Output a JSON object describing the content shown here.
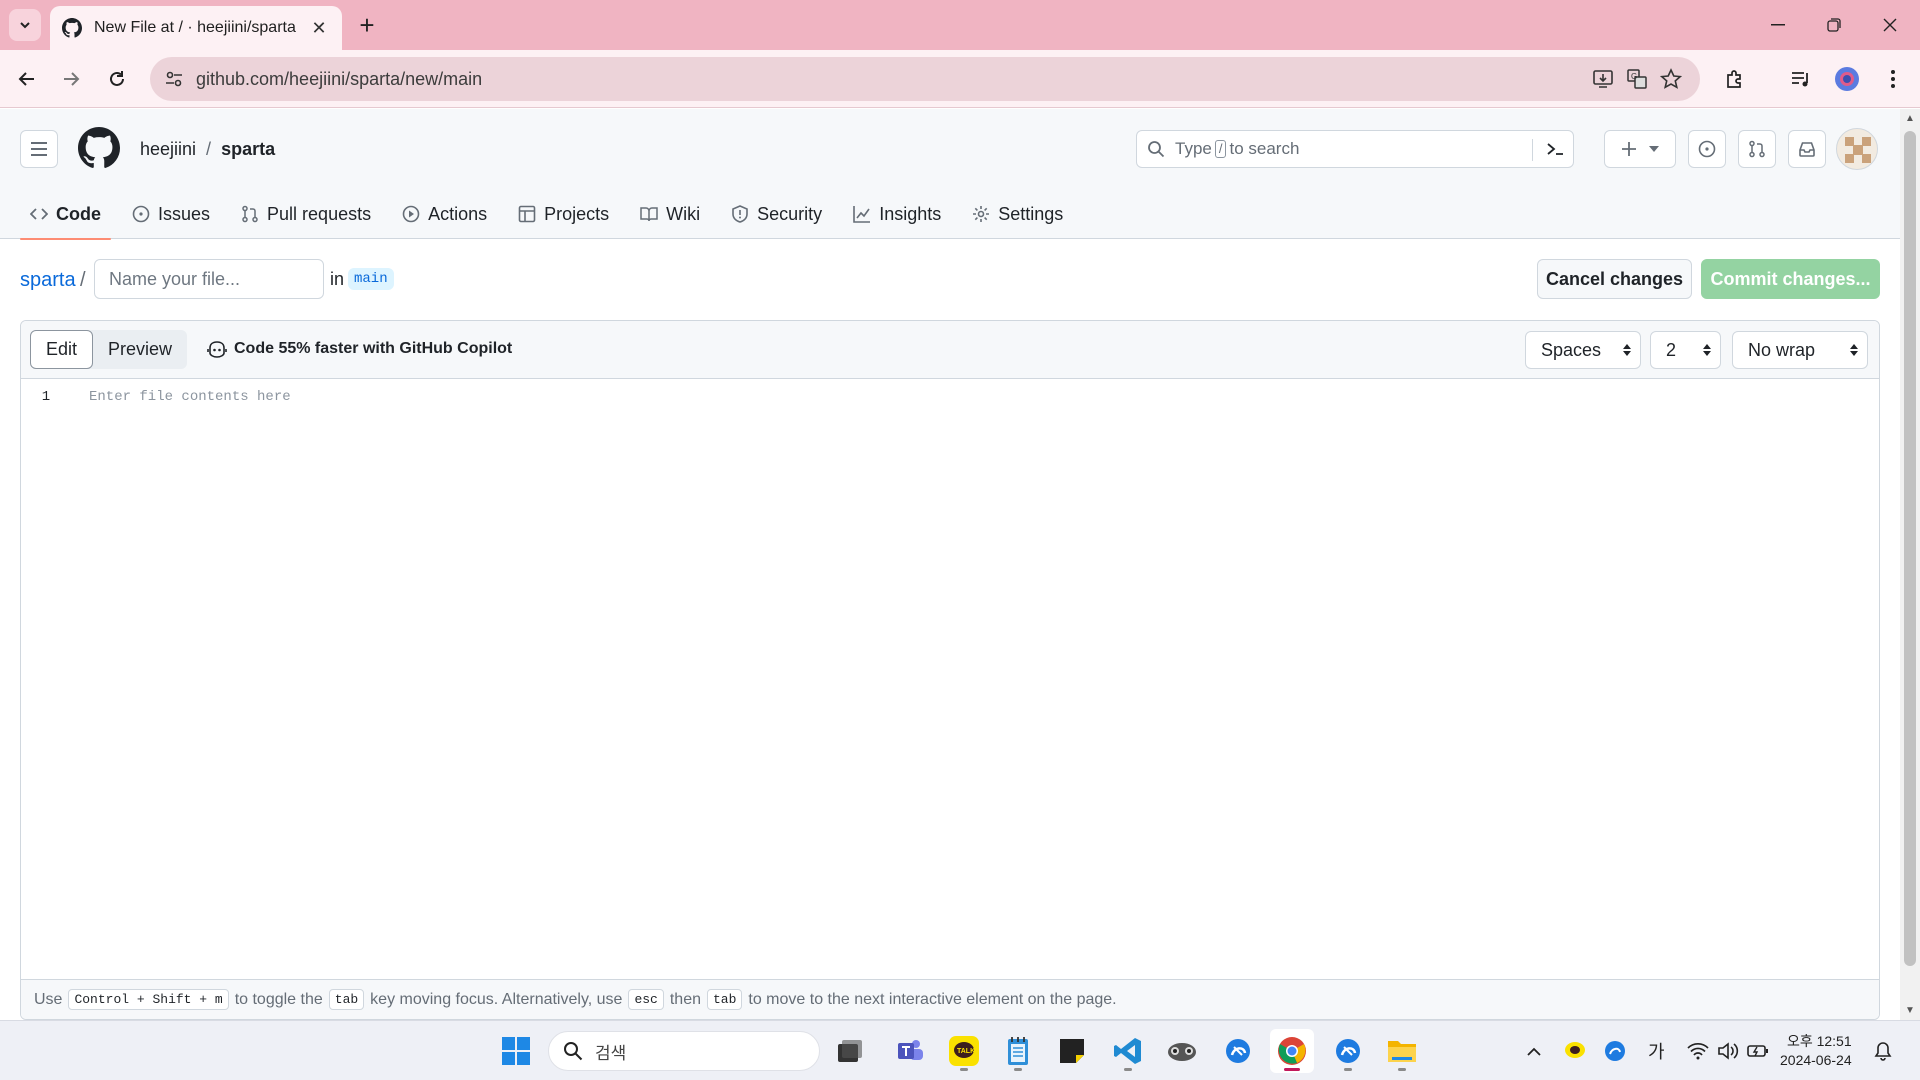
{
  "browser": {
    "tab_title": "New File at / · heejiini/sparta",
    "url": "github.com/heejiini/sparta/new/main"
  },
  "github": {
    "owner": "heejiini",
    "separator": "/",
    "repo": "sparta",
    "search_placeholder_prefix": "Type",
    "search_key": "/",
    "search_placeholder_suffix": "to search",
    "nav": [
      {
        "label": "Code",
        "icon": "code-icon"
      },
      {
        "label": "Issues",
        "icon": "issue-icon"
      },
      {
        "label": "Pull requests",
        "icon": "pull-request-icon"
      },
      {
        "label": "Actions",
        "icon": "play-icon"
      },
      {
        "label": "Projects",
        "icon": "table-icon"
      },
      {
        "label": "Wiki",
        "icon": "book-icon"
      },
      {
        "label": "Security",
        "icon": "shield-icon"
      },
      {
        "label": "Insights",
        "icon": "graph-icon"
      },
      {
        "label": "Settings",
        "icon": "gear-icon"
      }
    ],
    "accent": "#fd8c73"
  },
  "editor": {
    "breadcrumb_repo": "sparta",
    "breadcrumb_sep": "/",
    "filename_placeholder": "Name your file...",
    "in_label": "in",
    "branch": "main",
    "cancel_label": "Cancel changes",
    "commit_label": "Commit changes...",
    "tab_edit": "Edit",
    "tab_preview": "Preview",
    "copilot_text": "Code 55% faster with GitHub Copilot",
    "indent_mode": "Spaces",
    "indent_size": "2",
    "wrap_mode": "No wrap",
    "line_number": "1",
    "content_placeholder": "Enter file contents here",
    "help": {
      "use": "Use",
      "shortcut": "Control + Shift + m",
      "to_toggle": "to toggle the",
      "tab_key": "tab",
      "key_moving": "key moving focus. Alternatively, use",
      "esc_key": "esc",
      "then": "then",
      "tab_key2": "tab",
      "rest": "to move to the next interactive element on the page."
    }
  },
  "taskbar": {
    "search_placeholder": "검색",
    "ime": "가",
    "time": "오후 12:51",
    "date": "2024-06-24"
  }
}
